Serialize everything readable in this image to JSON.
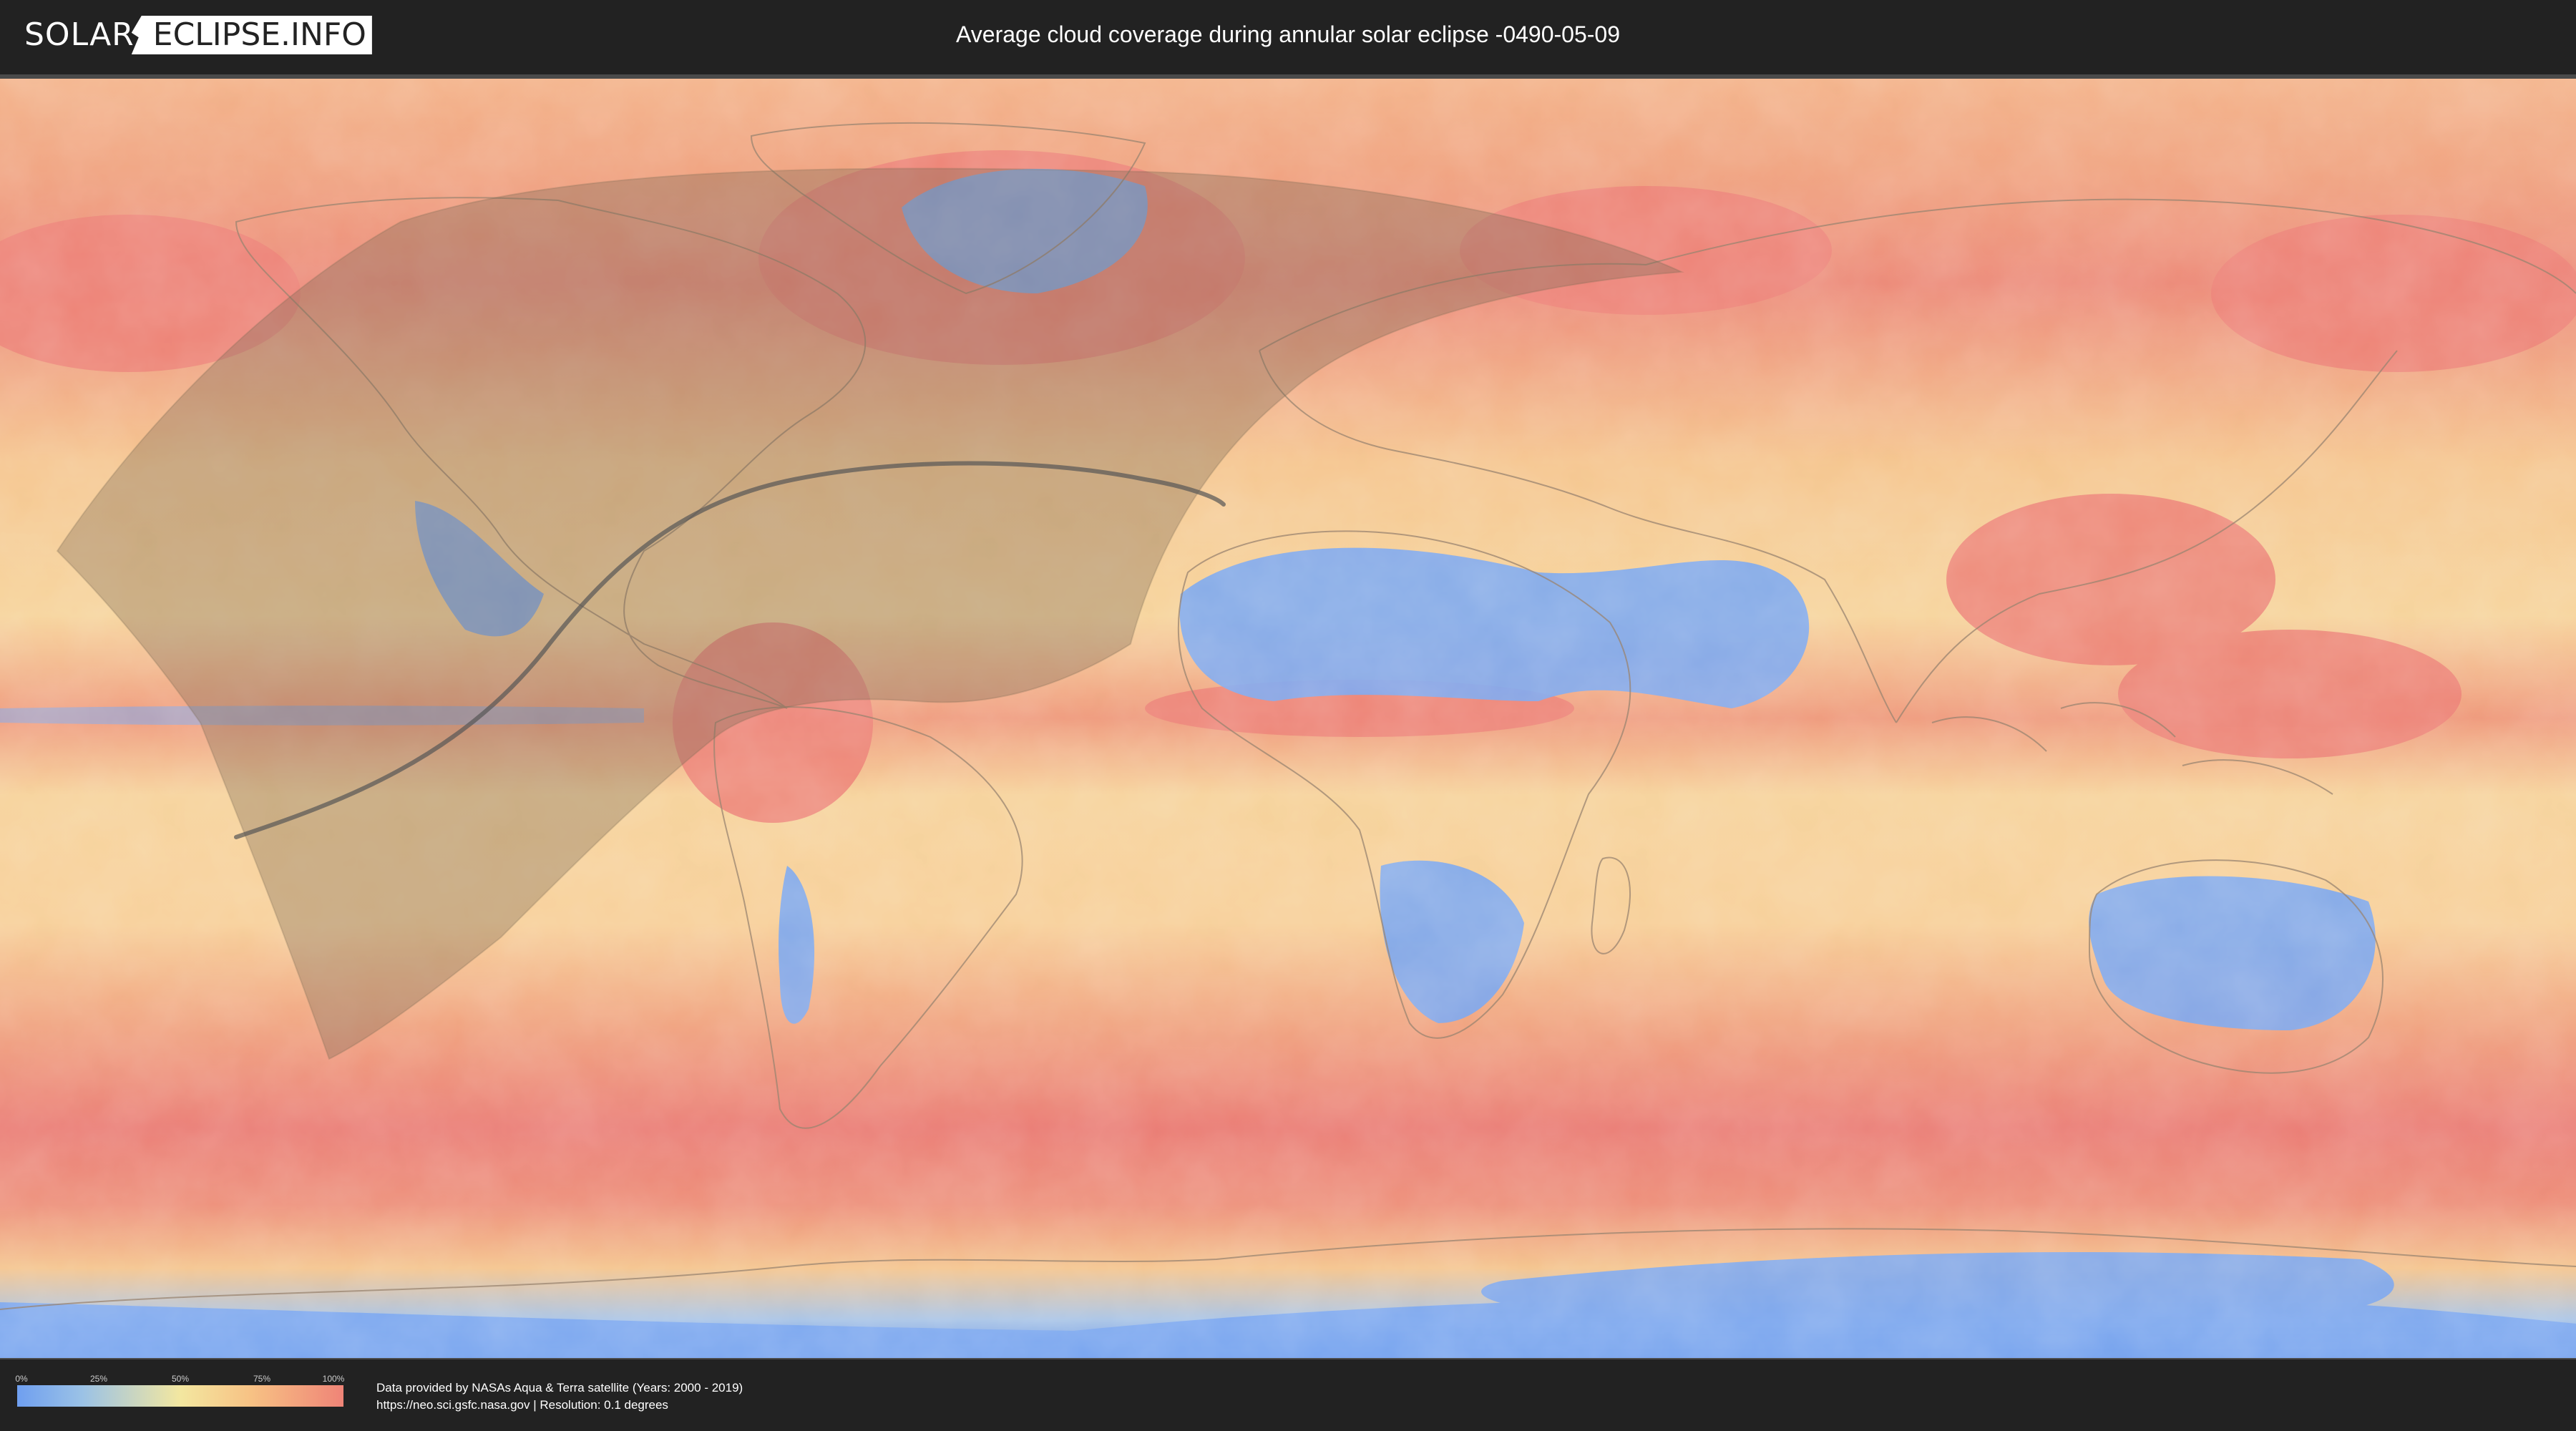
{
  "header": {
    "logo_left": "SOLAR",
    "logo_right": "ECLIPSE.INFO",
    "title": "Average cloud coverage during annular solar eclipse -0490-05-09"
  },
  "legend": {
    "ticks": [
      "0%",
      "25%",
      "50%",
      "75%",
      "100%"
    ],
    "tick_values": [
      0,
      25,
      50,
      75,
      100
    ],
    "gradient_colors": [
      "#6f9ff0",
      "#9bc2e6",
      "#f3e7a0",
      "#f7c184",
      "#ef8477"
    ]
  },
  "credits": {
    "line1": "Data provided by NASAs Aqua & Terra satellite (Years: 2000 - 2019)",
    "line2": "https://neo.sci.gsfc.nasa.gov | Resolution: 0.1 degrees"
  },
  "map": {
    "projection": "equirectangular",
    "eclipse_type": "annular",
    "colors": {
      "clear": "#6f9ff0",
      "mid": "#f6d69a",
      "cloudy": "#ec7f74",
      "visibility_zone": "#7a6a55",
      "central_path": "#555555",
      "coastline": "#9a8470"
    }
  }
}
